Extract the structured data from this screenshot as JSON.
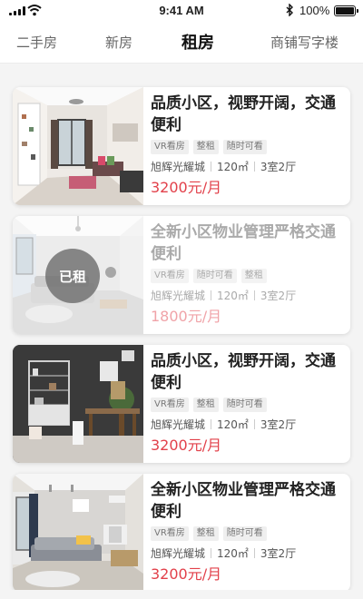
{
  "status_bar": {
    "time": "9:41 AM",
    "battery": "100%",
    "icons": [
      "signal-icon",
      "wifi-icon",
      "bluetooth-icon",
      "battery-icon"
    ]
  },
  "tabs": [
    {
      "label": "二手房",
      "active": false
    },
    {
      "label": "新房",
      "active": false
    },
    {
      "label": "租房",
      "active": true
    },
    {
      "label": "商铺写字楼",
      "active": false
    }
  ],
  "listings": [
    {
      "title": "品质小区，视野开阔，交通便利",
      "tags": [
        "VR看房",
        "整租",
        "随时可看"
      ],
      "community": "旭辉光耀城",
      "area": "120㎡",
      "layout": "3室2厅",
      "price": "3200元/月",
      "rented": false,
      "rented_label": ""
    },
    {
      "title": "全新小区物业管理严格交通便利",
      "tags": [
        "VR看房",
        "随时可看",
        "整租"
      ],
      "community": "旭辉光耀城",
      "area": "120㎡",
      "layout": "3室2厅",
      "price": "1800元/月",
      "rented": true,
      "rented_label": "已租"
    },
    {
      "title": "品质小区，视野开阔，交通便利",
      "tags": [
        "VR看房",
        "整租",
        "随时可看"
      ],
      "community": "旭辉光耀城",
      "area": "120㎡",
      "layout": "3室2厅",
      "price": "3200元/月",
      "rented": false,
      "rented_label": ""
    },
    {
      "title": "全新小区物业管理严格交通便利",
      "tags": [
        "VR看房",
        "整租",
        "随时可看"
      ],
      "community": "旭辉光耀城",
      "area": "120㎡",
      "layout": "3室2厅",
      "price": "3200元/月",
      "rented": false,
      "rented_label": ""
    }
  ],
  "colors": {
    "price": "#e2404a",
    "price_rented": "#f0a3a8",
    "tag_bg": "#efefef"
  }
}
